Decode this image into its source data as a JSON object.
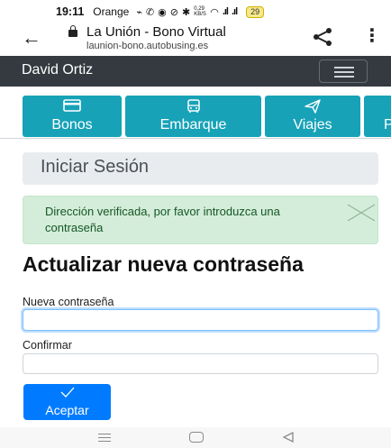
{
  "status_bar": {
    "time": "19:11",
    "carrier": "Orange",
    "icons": [
      "cast-icon",
      "whatsapp-icon",
      "whatsapp-business-icon",
      "do-not-disturb-icon",
      "bluetooth-icon",
      "data-speed-icon",
      "wifi-icon",
      "signal-icon",
      "signal-icon"
    ],
    "data_speed": "0,29 KB/S",
    "battery": "29"
  },
  "browser": {
    "page_title": "La Unión - Bono Virtual",
    "url": "launion-bono.autobusing.es"
  },
  "navbar": {
    "brand": "David Ortiz",
    "bg_color": "#343a40"
  },
  "tabs": [
    {
      "label": "Bonos",
      "icon": "card-icon"
    },
    {
      "label": "Embarque",
      "icon": "bus-icon"
    },
    {
      "label": "Viajes",
      "icon": "send-icon"
    },
    {
      "label": "P",
      "icon": ""
    }
  ],
  "tab_color": "#17a2b8",
  "login_header": "Iniciar Sesión",
  "alert": {
    "message": "Dirección verificada, por favor introduzca una contraseña",
    "bg_color": "#d4edda"
  },
  "form": {
    "title": "Actualizar nueva contraseña",
    "new_password_label": "Nueva contraseña",
    "new_password_value": "",
    "confirm_label": "Confirmar",
    "confirm_value": "",
    "submit_label": "Aceptar",
    "submit_color": "#007bff"
  }
}
